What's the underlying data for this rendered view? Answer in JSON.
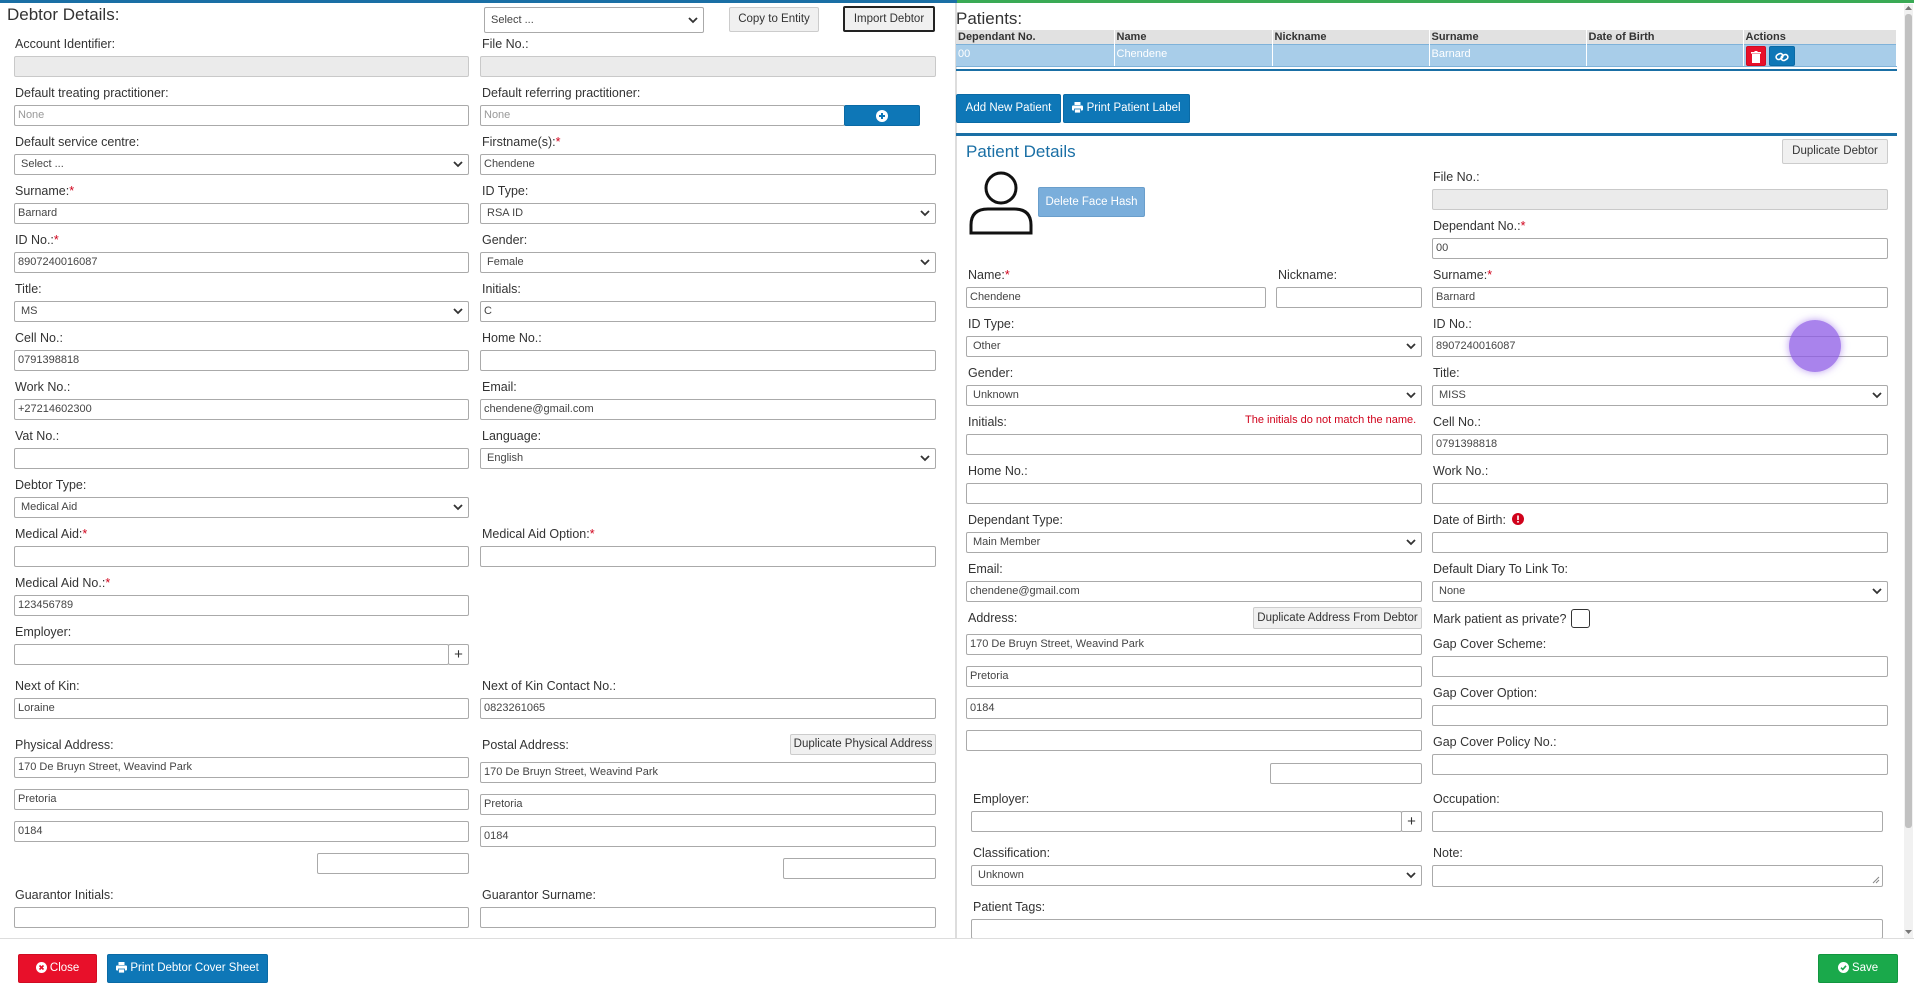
{
  "debtor": {
    "title": "Debtor Details:",
    "entity_select": "Select ...",
    "copy_to_entity": "Copy to Entity",
    "import_debtor": "Import Debtor",
    "account_identifier_label": "Account Identifier:",
    "account_identifier": "",
    "file_no_label": "File No.:",
    "file_no": "",
    "treating_label": "Default treating practitioner:",
    "treating_value": "None",
    "referring_label": "Default referring practitioner:",
    "referring_value": "None",
    "service_centre_label": "Default service centre:",
    "service_centre_value": "Select ...",
    "firstname_label": "Firstname(s):",
    "firstname": "Chendene",
    "surname_label": "Surname:",
    "surname": "Barnard",
    "id_type_label": "ID Type:",
    "id_type": "RSA ID",
    "id_no_label": "ID No.:",
    "id_no": "8907240016087",
    "gender_label": "Gender:",
    "gender": "Female",
    "title_label": "Title:",
    "title_value": "MS",
    "initials_label": "Initials:",
    "initials": "C",
    "cell_label": "Cell No.:",
    "cell": "0791398818",
    "home_label": "Home No.:",
    "home": "",
    "work_label": "Work No.:",
    "work": "+27214602300",
    "email_label": "Email:",
    "email": "chendene@gmail.com",
    "vat_label": "Vat No.:",
    "vat": "",
    "language_label": "Language:",
    "language": "English",
    "debtor_type_label": "Debtor Type:",
    "debtor_type": "Medical Aid",
    "medical_aid_label": "Medical Aid:",
    "medical_aid": "",
    "medical_aid_option_label": "Medical Aid Option:",
    "medical_aid_option": "",
    "medical_aid_no_label": "Medical Aid No.:",
    "medical_aid_no": "123456789",
    "employer_label": "Employer:",
    "employer": "",
    "next_of_kin_label": "Next of Kin:",
    "next_of_kin": "Loraine",
    "next_of_kin_contact_label": "Next of Kin Contact No.:",
    "next_of_kin_contact": "0823261065",
    "physical_address_label": "Physical Address:",
    "postal_address_label": "Postal Address:",
    "duplicate_physical": "Duplicate Physical Address",
    "physical_line1": "170 De Bruyn Street, Weavind Park",
    "physical_line2": "Pretoria",
    "physical_line3": "0184",
    "postal_line1": "170 De Bruyn Street, Weavind Park",
    "postal_line2": "Pretoria",
    "postal_line3": "0184",
    "guarantor_initials_label": "Guarantor Initials:",
    "guarantor_surname_label": "Guarantor Surname:"
  },
  "patients": {
    "title": "Patients:",
    "columns": [
      "Dependant No.",
      "Name",
      "Nickname",
      "Surname",
      "Date of Birth",
      "Actions"
    ],
    "rows": [
      {
        "dependant_no": "00",
        "name": "Chendene",
        "nickname": "",
        "surname": "Barnard",
        "dob": ""
      }
    ],
    "add_new": "Add New Patient",
    "print_label": "Print Patient Label"
  },
  "patient": {
    "title": "Patient Details",
    "duplicate_debtor": "Duplicate Debtor",
    "delete_face_hash": "Delete Face Hash",
    "file_no_label": "File No.:",
    "file_no": "",
    "dependant_no_label": "Dependant No.:",
    "dependant_no": "00",
    "name_label": "Name:",
    "name": "Chendene",
    "nickname_label": "Nickname:",
    "nickname": "",
    "surname_label": "Surname:",
    "surname": "Barnard",
    "id_type_label": "ID Type:",
    "id_type": "Other",
    "id_no_label": "ID No.:",
    "id_no": "8907240016087",
    "gender_label": "Gender:",
    "gender": "Unknown",
    "title_label": "Title:",
    "title_value": "MISS",
    "initials_label": "Initials:",
    "initials_error": "The initials do not match the name.",
    "initials": "",
    "cell_label": "Cell No.:",
    "cell": "0791398818",
    "home_label": "Home No.:",
    "work_label": "Work No.:",
    "dependant_type_label": "Dependant Type:",
    "dependant_type": "Main Member",
    "dob_label": "Date of Birth:",
    "email_label": "Email:",
    "email": "chendene@gmail.com",
    "default_diary_label": "Default Diary To Link To:",
    "default_diary": "None",
    "address_label": "Address:",
    "duplicate_address": "Duplicate Address From Debtor",
    "address_line1": "170 De Bruyn Street, Weavind Park",
    "address_line2": "Pretoria",
    "address_line3": "0184",
    "private_label": "Mark patient as private?",
    "gap_scheme_label": "Gap Cover Scheme:",
    "gap_option_label": "Gap Cover Option:",
    "gap_policy_label": "Gap Cover Policy No.:",
    "employer_label": "Employer:",
    "occupation_label": "Occupation:",
    "classification_label": "Classification:",
    "classification": "Unknown",
    "note_label": "Note:",
    "tags_label": "Patient Tags:"
  },
  "footer": {
    "close": "Close",
    "print_cover": "Print Debtor Cover Sheet",
    "save": "Save"
  },
  "colors": {
    "accent_blue": "#0e77b7",
    "danger_red": "#e8102a",
    "success_green": "#1aa94b",
    "selected_row": "#a8cde9"
  }
}
